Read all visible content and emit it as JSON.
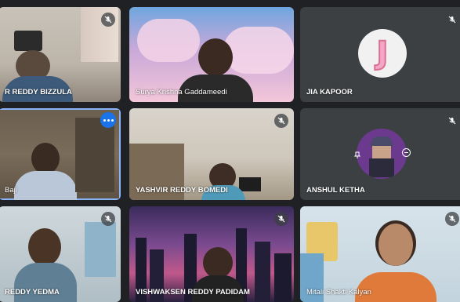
{
  "participants": [
    {
      "name": "R REDDY BIZZULA",
      "muted": true
    },
    {
      "name": "Surya Krishna Gaddameedi",
      "muted": false
    },
    {
      "name": "JIA KAPOOR",
      "muted": true,
      "avatar_letter": "J"
    },
    {
      "name": "Baji",
      "muted": false,
      "active": true
    },
    {
      "name": "YASHVIR REDDY BOMEDI",
      "muted": true
    },
    {
      "name": "ANSHUL KETHA",
      "muted": true
    },
    {
      "name": "REDDY YEDMA",
      "muted": true
    },
    {
      "name": "VISHWAKSEN REDDY PADIDAM",
      "muted": true
    },
    {
      "name": "Mitali Shakti Kalyan",
      "muted": true
    }
  ],
  "colors": {
    "background": "#202124",
    "tile": "#3c4043",
    "active_border": "#8ab4f8",
    "more_button": "#1a73e8"
  }
}
